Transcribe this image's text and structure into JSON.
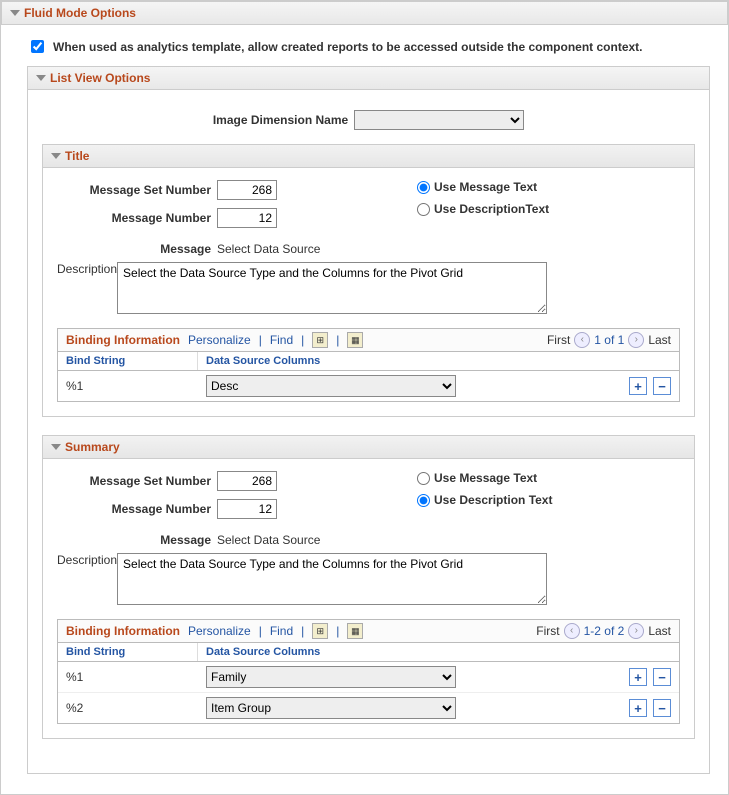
{
  "fluid_header": "Fluid Mode Options",
  "checkbox_label": "When used as analytics template, allow created reports to be accessed outside the component context.",
  "checkbox_checked": true,
  "list_view_header": "List View Options",
  "image_dim_label": "Image Dimension Name",
  "image_dim_value": "",
  "labels": {
    "msg_set": "Message Set Number",
    "msg_num": "Message Number",
    "message": "Message",
    "description": "Description",
    "use_msg": "Use Message Text",
    "use_desc_t": "Use DescriptionText",
    "use_desc_s": "Use Description Text"
  },
  "grid_labels": {
    "title": "Binding Information",
    "personalize": "Personalize",
    "find": "Find",
    "first": "First",
    "last": "Last",
    "bind_string": "Bind String",
    "ds_columns": "Data Source Columns"
  },
  "title_block": {
    "header": "Title",
    "msg_set": "268",
    "msg_num": "12",
    "radio": "msg",
    "message": "Select Data Source",
    "description": "Select the Data Source Type and the Columns for the Pivot Grid",
    "pager": "1 of 1",
    "rows": [
      {
        "bind": "%1",
        "ds": "Desc"
      }
    ]
  },
  "summary_block": {
    "header": "Summary",
    "msg_set": "268",
    "msg_num": "12",
    "radio": "desc",
    "message": "Select Data Source",
    "description": "Select the Data Source Type and the Columns for the Pivot Grid",
    "pager": "1-2 of 2",
    "rows": [
      {
        "bind": "%1",
        "ds": "Family"
      },
      {
        "bind": "%2",
        "ds": "Item Group"
      }
    ]
  }
}
